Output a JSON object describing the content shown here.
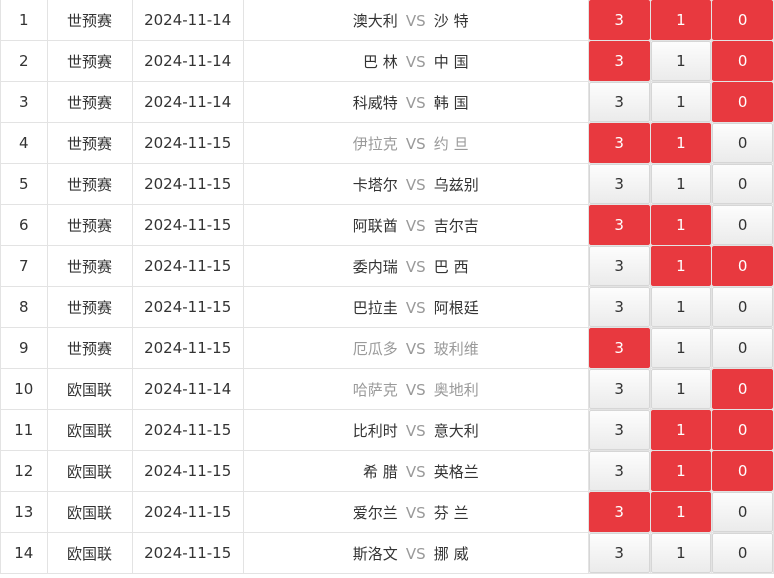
{
  "colors": {
    "selected": "#e8393f",
    "muted_team": "#9a9a9a"
  },
  "vs_label": "VS",
  "rows": [
    {
      "n": "1",
      "league": "世预赛",
      "date": "2024-11-14",
      "home": "澳大利",
      "away": "沙 特",
      "home_muted": false,
      "away_muted": false,
      "w": "3",
      "d": "1",
      "l": "0",
      "sel": [
        true,
        true,
        true
      ]
    },
    {
      "n": "2",
      "league": "世预赛",
      "date": "2024-11-14",
      "home": "巴 林",
      "away": "中 国",
      "home_muted": false,
      "away_muted": false,
      "w": "3",
      "d": "1",
      "l": "0",
      "sel": [
        true,
        false,
        true
      ]
    },
    {
      "n": "3",
      "league": "世预赛",
      "date": "2024-11-14",
      "home": "科威特",
      "away": "韩 国",
      "home_muted": false,
      "away_muted": false,
      "w": "3",
      "d": "1",
      "l": "0",
      "sel": [
        false,
        false,
        true
      ]
    },
    {
      "n": "4",
      "league": "世预赛",
      "date": "2024-11-15",
      "home": "伊拉克",
      "away": "约 旦",
      "home_muted": true,
      "away_muted": true,
      "w": "3",
      "d": "1",
      "l": "0",
      "sel": [
        true,
        true,
        false
      ]
    },
    {
      "n": "5",
      "league": "世预赛",
      "date": "2024-11-15",
      "home": "卡塔尔",
      "away": "乌兹别",
      "home_muted": false,
      "away_muted": false,
      "w": "3",
      "d": "1",
      "l": "0",
      "sel": [
        false,
        false,
        false
      ]
    },
    {
      "n": "6",
      "league": "世预赛",
      "date": "2024-11-15",
      "home": "阿联酋",
      "away": "吉尔吉",
      "home_muted": false,
      "away_muted": false,
      "w": "3",
      "d": "1",
      "l": "0",
      "sel": [
        true,
        true,
        false
      ]
    },
    {
      "n": "7",
      "league": "世预赛",
      "date": "2024-11-15",
      "home": "委内瑞",
      "away": "巴 西",
      "home_muted": false,
      "away_muted": false,
      "w": "3",
      "d": "1",
      "l": "0",
      "sel": [
        false,
        true,
        true
      ]
    },
    {
      "n": "8",
      "league": "世预赛",
      "date": "2024-11-15",
      "home": "巴拉圭",
      "away": "阿根廷",
      "home_muted": false,
      "away_muted": false,
      "w": "3",
      "d": "1",
      "l": "0",
      "sel": [
        false,
        false,
        false
      ]
    },
    {
      "n": "9",
      "league": "世预赛",
      "date": "2024-11-15",
      "home": "厄瓜多",
      "away": "玻利维",
      "home_muted": true,
      "away_muted": true,
      "w": "3",
      "d": "1",
      "l": "0",
      "sel": [
        true,
        false,
        false
      ]
    },
    {
      "n": "10",
      "league": "欧国联",
      "date": "2024-11-14",
      "home": "哈萨克",
      "away": "奥地利",
      "home_muted": true,
      "away_muted": true,
      "w": "3",
      "d": "1",
      "l": "0",
      "sel": [
        false,
        false,
        true
      ]
    },
    {
      "n": "11",
      "league": "欧国联",
      "date": "2024-11-15",
      "home": "比利时",
      "away": "意大利",
      "home_muted": false,
      "away_muted": false,
      "w": "3",
      "d": "1",
      "l": "0",
      "sel": [
        false,
        true,
        true
      ]
    },
    {
      "n": "12",
      "league": "欧国联",
      "date": "2024-11-15",
      "home": "希 腊",
      "away": "英格兰",
      "home_muted": false,
      "away_muted": false,
      "w": "3",
      "d": "1",
      "l": "0",
      "sel": [
        false,
        true,
        true
      ]
    },
    {
      "n": "13",
      "league": "欧国联",
      "date": "2024-11-15",
      "home": "爱尔兰",
      "away": "芬 兰",
      "home_muted": false,
      "away_muted": false,
      "w": "3",
      "d": "1",
      "l": "0",
      "sel": [
        true,
        true,
        false
      ]
    },
    {
      "n": "14",
      "league": "欧国联",
      "date": "2024-11-15",
      "home": "斯洛文",
      "away": "挪 威",
      "home_muted": false,
      "away_muted": false,
      "w": "3",
      "d": "1",
      "l": "0",
      "sel": [
        false,
        false,
        false
      ]
    }
  ]
}
